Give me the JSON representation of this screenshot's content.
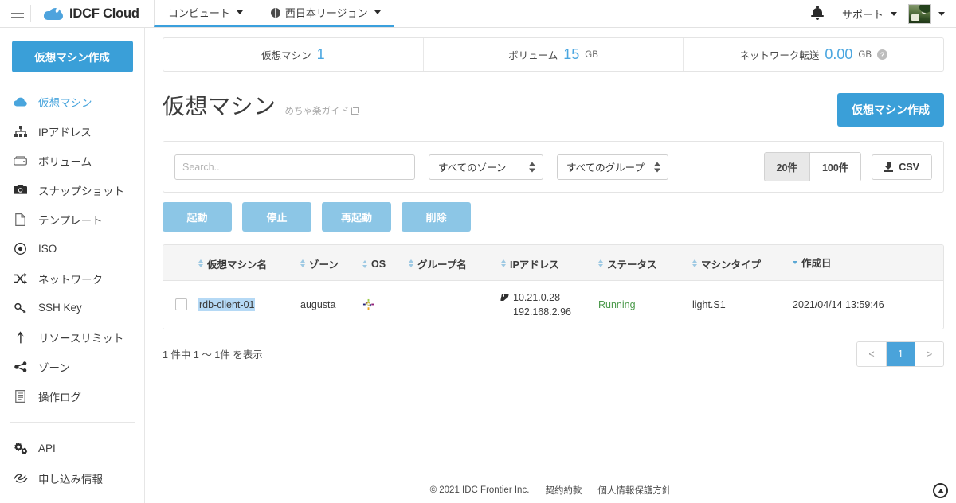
{
  "header": {
    "menu_icon": "hamburger-icon",
    "brand": "IDCF Cloud",
    "tabs": [
      {
        "label": "コンピュート",
        "icon": ""
      },
      {
        "label": "西日本リージョン",
        "icon": "globe-icon"
      }
    ],
    "notification_icon": "bell-icon",
    "support_label": "サポート",
    "avatar": "user-avatar"
  },
  "sidebar": {
    "create_button": "仮想マシン作成",
    "items": [
      {
        "label": "仮想マシン",
        "icon": "cloud-icon",
        "active": true
      },
      {
        "label": "IPアドレス",
        "icon": "sitemap-icon",
        "active": false
      },
      {
        "label": "ボリューム",
        "icon": "hdd-icon",
        "active": false
      },
      {
        "label": "スナップショット",
        "icon": "camera-icon",
        "active": false
      },
      {
        "label": "テンプレート",
        "icon": "file-icon",
        "active": false
      },
      {
        "label": "ISO",
        "icon": "disc-icon",
        "active": false
      },
      {
        "label": "ネットワーク",
        "icon": "shuffle-icon",
        "active": false
      },
      {
        "label": "SSH Key",
        "icon": "key-icon",
        "active": false
      },
      {
        "label": "リソースリミット",
        "icon": "arrow-up-icon",
        "active": false
      },
      {
        "label": "ゾーン",
        "icon": "share-icon",
        "active": false
      }
    ],
    "items2": [
      {
        "label": "操作ログ",
        "icon": "log-icon",
        "active": false
      }
    ],
    "items3": [
      {
        "label": "API",
        "icon": "gears-icon",
        "active": false
      },
      {
        "label": "申し込み情報",
        "icon": "handshake-icon",
        "active": false
      }
    ]
  },
  "stats": [
    {
      "label": "仮想マシン",
      "value": "1",
      "unit": "",
      "help": false
    },
    {
      "label": "ボリューム",
      "value": "15",
      "unit": "GB",
      "help": false
    },
    {
      "label": "ネットワーク転送",
      "value": "0.00",
      "unit": "GB",
      "help": true
    }
  ],
  "page": {
    "title": "仮想マシン",
    "guide_label": "めちゃ楽ガイド",
    "guide_icon": "external-link-icon",
    "create_button": "仮想マシン作成"
  },
  "filters": {
    "search_placeholder": "Search..",
    "search_value": "",
    "zone_select": "すべてのゾーン",
    "group_select": "すべてのグループ",
    "page_sizes": [
      {
        "label": "20件",
        "selected": true
      },
      {
        "label": "100件",
        "selected": false
      }
    ],
    "csv_label": "CSV",
    "csv_icon": "download-icon"
  },
  "actions": [
    {
      "label": "起動"
    },
    {
      "label": "停止"
    },
    {
      "label": "再起動"
    },
    {
      "label": "削除"
    }
  ],
  "table": {
    "columns": [
      {
        "label": "仮想マシン名",
        "sort": "none"
      },
      {
        "label": "ゾーン",
        "sort": "none"
      },
      {
        "label": "OS",
        "sort": "none"
      },
      {
        "label": "グループ名",
        "sort": "none"
      },
      {
        "label": "IPアドレス",
        "sort": "none"
      },
      {
        "label": "ステータス",
        "sort": "none"
      },
      {
        "label": "マシンタイプ",
        "sort": "none"
      },
      {
        "label": "作成日",
        "sort": "desc"
      }
    ],
    "rows": [
      {
        "checked": false,
        "name": "rdb-client-01",
        "name_selected": true,
        "zone": "augusta",
        "os_icon": "centos-logo-icon",
        "group": "",
        "ip_primary": "10.21.0.28",
        "ip_secondary": "192.168.2.96",
        "ip_icon": "tag-icon",
        "status": "Running",
        "machine_type": "light.S1",
        "created": "2021/04/14 13:59:46"
      }
    ],
    "summary": "1 件中 1 〜 1件 を表示",
    "pagination": {
      "prev": "<",
      "pages": [
        "1"
      ],
      "current": "1",
      "next": ">"
    }
  },
  "footer": {
    "copyright": "© 2021 IDC Frontier Inc.",
    "links": [
      "契約約款",
      "個人情報保護方針"
    ],
    "scroll_top_icon": "arrow-up-circle-icon"
  },
  "colors": {
    "accent": "#3a9fd8",
    "accent_light": "#8cc6e6",
    "status_running": "#4c9a4c",
    "selection": "#b5d9f5"
  }
}
